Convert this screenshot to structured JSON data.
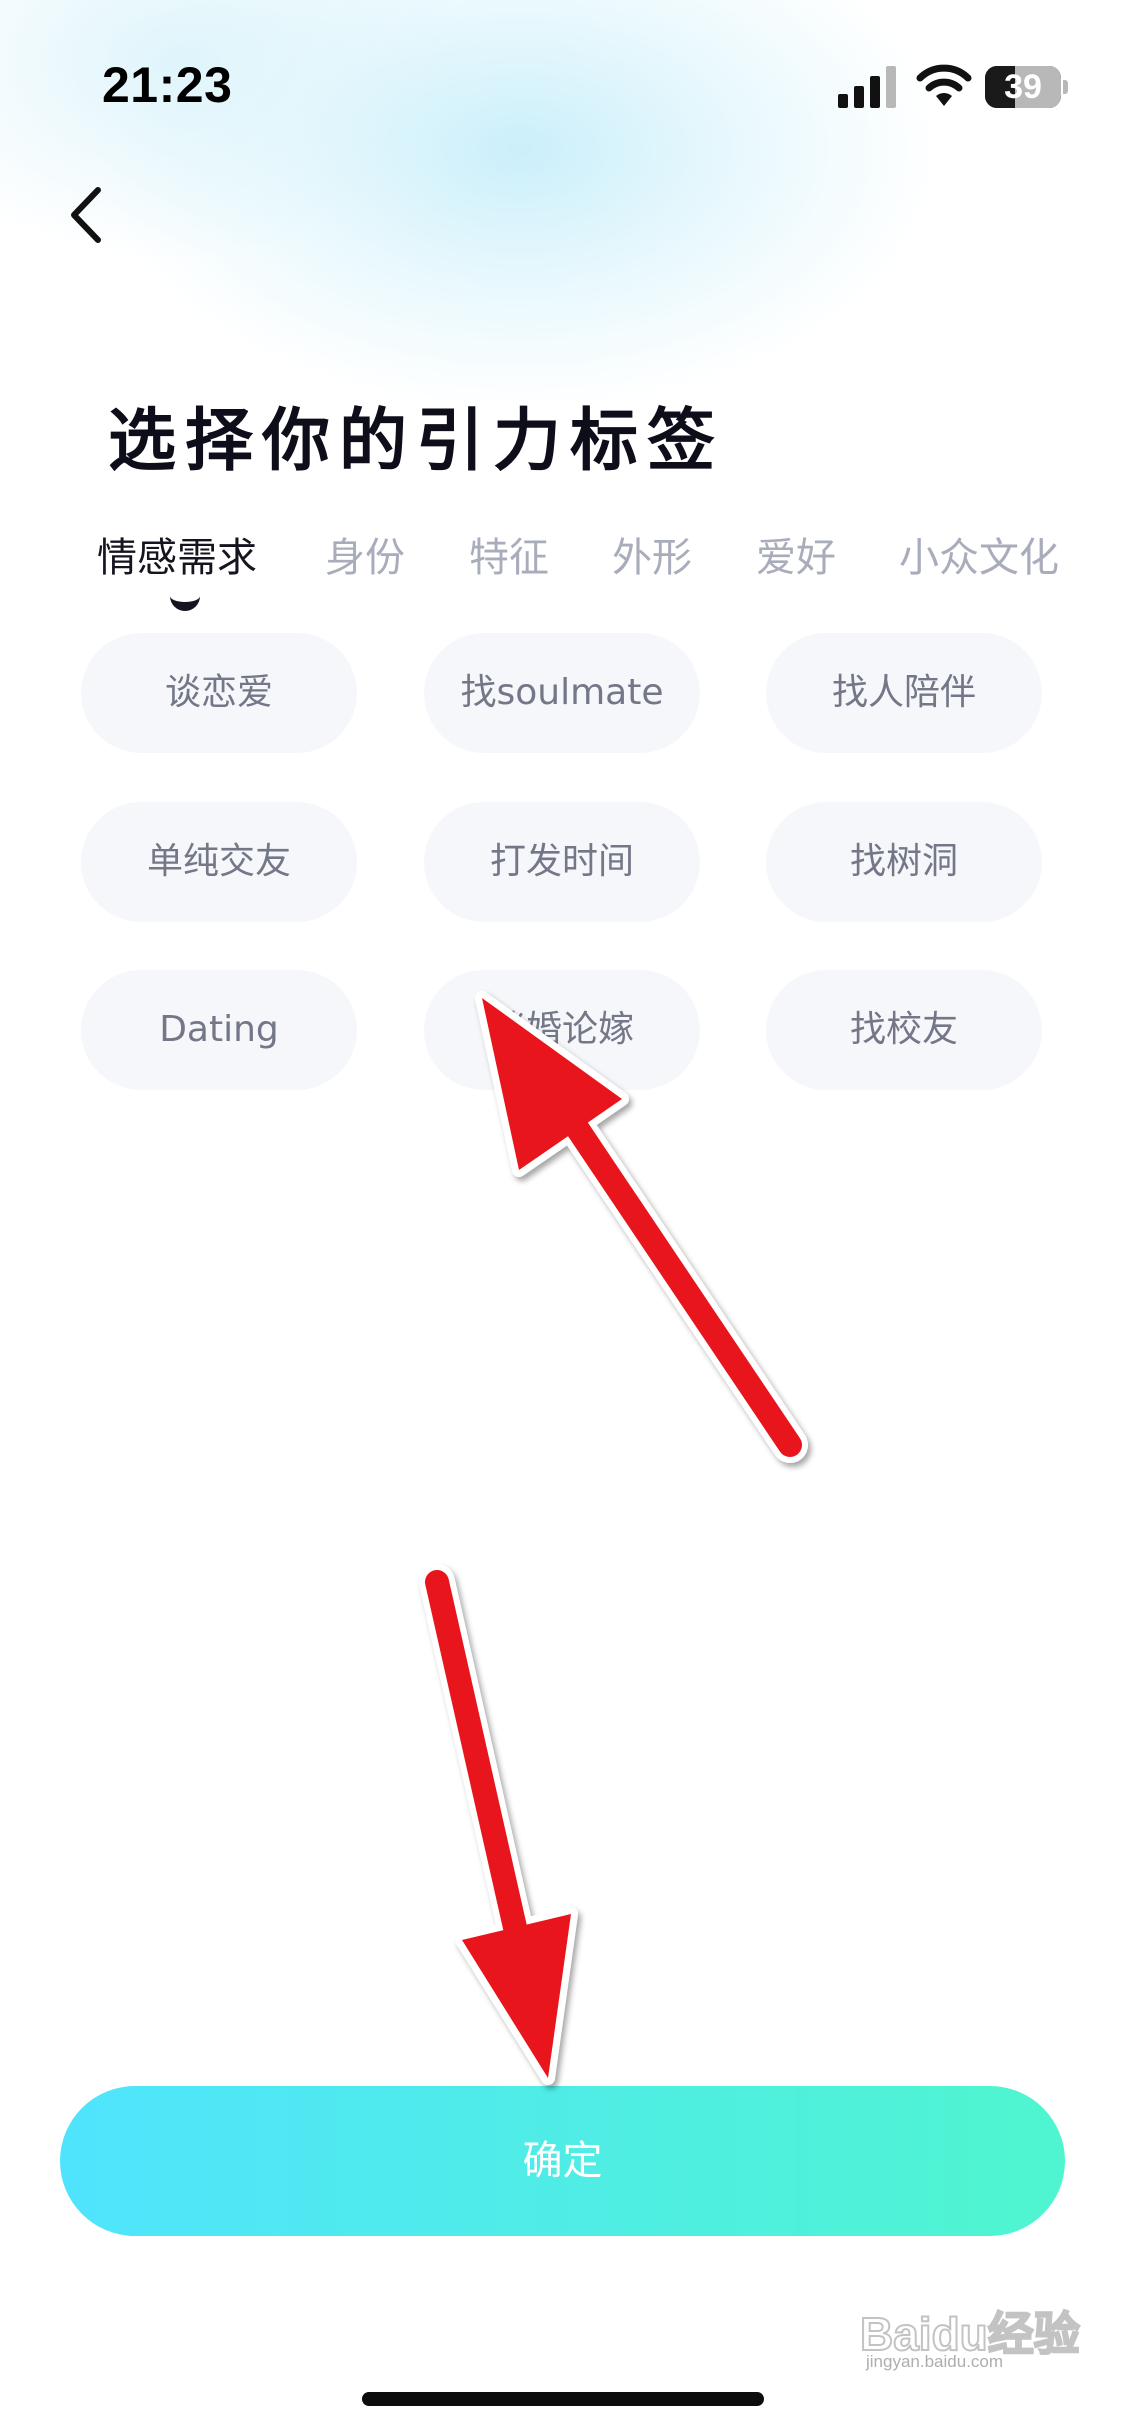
{
  "status_bar": {
    "time": "21:23",
    "battery_level": "39",
    "icons": [
      "cellular-signal-icon",
      "wifi-icon",
      "battery-icon"
    ]
  },
  "nav": {
    "back_icon": "chevron-left-icon"
  },
  "title": "选择你的引力标签",
  "tabs": [
    {
      "label": "情感需求",
      "active": true
    },
    {
      "label": "身份",
      "active": false
    },
    {
      "label": "特征",
      "active": false
    },
    {
      "label": "外形",
      "active": false
    },
    {
      "label": "爱好",
      "active": false
    },
    {
      "label": "小众文化",
      "active": false
    }
  ],
  "tags": [
    "谈恋爱",
    "找soulmate",
    "找人陪伴",
    "单纯交友",
    "打发时间",
    "找树洞",
    "Dating",
    "谈婚论嫁",
    "找校友"
  ],
  "confirm_button": {
    "label": "确定"
  },
  "colors": {
    "button_gradient_start": "#4fe4fd",
    "button_gradient_end": "#4ff5cf",
    "tag_background": "#f6f7fb",
    "tag_text": "#737787",
    "tab_inactive": "#a9adbb",
    "tab_active": "#15151f",
    "annotation_arrow": "#e8141a"
  },
  "watermark": {
    "text": "Baidu经验",
    "subtext": "jingyan.baidu.com"
  }
}
